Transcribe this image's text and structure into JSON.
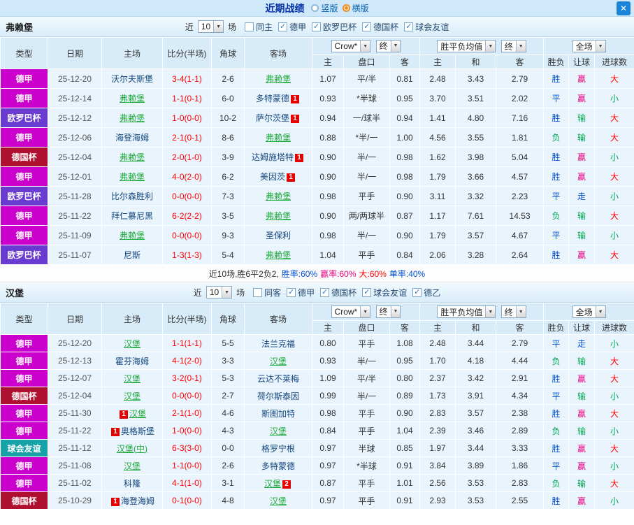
{
  "titlebar": {
    "title": "近期战绩",
    "radio_vertical": "竖版",
    "radio_horizontal": "横版",
    "close_icon": "✕"
  },
  "colors": {
    "type_colors": {
      "德甲": "#cc00cc",
      "欧罗巴杯": "#6a3bd1",
      "德国杯": "#b01030",
      "球会友谊": "#17a2a8"
    },
    "result_colors": {
      "胜": "#0050d0",
      "平": "#0050d0",
      "负": "#00a651",
      "赢": "#e6007e",
      "输": "#00a651",
      "走": "#0050d0",
      "大": "#ff0000",
      "小": "#00a651"
    }
  },
  "sections": [
    {
      "team": "弗赖堡",
      "filter": {
        "prefix": "近",
        "count": "10",
        "suffix": "场",
        "checkboxes": [
          {
            "label": "同主",
            "checked": false
          },
          {
            "label": "德甲",
            "checked": true
          },
          {
            "label": "欧罗巴杯",
            "checked": true
          },
          {
            "label": "德国杯",
            "checked": true
          },
          {
            "label": "球会友谊",
            "checked": true
          }
        ]
      },
      "header": {
        "static": [
          "类型",
          "日期",
          "主场",
          "比分(半场)",
          "角球",
          "客场"
        ],
        "odds_source": "Crow*",
        "odds_period": "终",
        "wdl_avg": "胜平负均值",
        "wdl_period": "终",
        "scope": "全场",
        "sub": [
          "主",
          "盘口",
          "客",
          "主",
          "和",
          "客",
          "胜负",
          "让球",
          "进球数"
        ]
      },
      "rows": [
        {
          "type": "德甲",
          "date": "25-12-20",
          "home": "沃尔夫斯堡",
          "home_focus": false,
          "home_badge": "",
          "score": "3-4(1-1)",
          "corner": "2-6",
          "away": "弗赖堡",
          "away_focus": true,
          "away_badge": "",
          "ah_home": "1.07",
          "handicap": "平/半",
          "ah_away": "0.81",
          "eu_home": "2.48",
          "eu_draw": "3.43",
          "eu_away": "2.79",
          "res_wdl": "胜",
          "res_ah": "赢",
          "res_ou": "大"
        },
        {
          "type": "德甲",
          "date": "25-12-14",
          "home": "弗赖堡",
          "home_focus": true,
          "home_badge": "",
          "score": "1-1(0-1)",
          "corner": "6-0",
          "away": "多特蒙德",
          "away_focus": false,
          "away_badge": "1",
          "ah_home": "0.93",
          "handicap": "*半球",
          "ah_away": "0.95",
          "eu_home": "3.70",
          "eu_draw": "3.51",
          "eu_away": "2.02",
          "res_wdl": "平",
          "res_ah": "赢",
          "res_ou": "小"
        },
        {
          "type": "欧罗巴杯",
          "date": "25-12-12",
          "home": "弗赖堡",
          "home_focus": true,
          "home_badge": "",
          "score": "1-0(0-0)",
          "corner": "10-2",
          "away": "萨尔茨堡",
          "away_focus": false,
          "away_badge": "1",
          "ah_home": "0.94",
          "handicap": "一/球半",
          "ah_away": "0.94",
          "eu_home": "1.41",
          "eu_draw": "4.80",
          "eu_away": "7.16",
          "res_wdl": "胜",
          "res_ah": "输",
          "res_ou": "大"
        },
        {
          "type": "德甲",
          "date": "25-12-06",
          "home": "海登海姆",
          "home_focus": false,
          "home_badge": "",
          "score": "2-1(0-1)",
          "corner": "8-6",
          "away": "弗赖堡",
          "away_focus": true,
          "away_badge": "",
          "ah_home": "0.88",
          "handicap": "*半/一",
          "ah_away": "1.00",
          "eu_home": "4.56",
          "eu_draw": "3.55",
          "eu_away": "1.81",
          "res_wdl": "负",
          "res_ah": "输",
          "res_ou": "大"
        },
        {
          "type": "德国杯",
          "date": "25-12-04",
          "home": "弗赖堡",
          "home_focus": true,
          "home_badge": "",
          "score": "2-0(1-0)",
          "corner": "3-9",
          "away": "达姆施塔特",
          "away_focus": false,
          "away_badge": "1",
          "ah_home": "0.90",
          "handicap": "半/一",
          "ah_away": "0.98",
          "eu_home": "1.62",
          "eu_draw": "3.98",
          "eu_away": "5.04",
          "res_wdl": "胜",
          "res_ah": "赢",
          "res_ou": "小"
        },
        {
          "type": "德甲",
          "date": "25-12-01",
          "home": "弗赖堡",
          "home_focus": true,
          "home_badge": "",
          "score": "4-0(2-0)",
          "corner": "6-2",
          "away": "美因茨",
          "away_focus": false,
          "away_badge": "1",
          "ah_home": "0.90",
          "handicap": "半/一",
          "ah_away": "0.98",
          "eu_home": "1.79",
          "eu_draw": "3.66",
          "eu_away": "4.57",
          "res_wdl": "胜",
          "res_ah": "赢",
          "res_ou": "大"
        },
        {
          "type": "欧罗巴杯",
          "date": "25-11-28",
          "home": "比尔森胜利",
          "home_focus": false,
          "home_badge": "",
          "score": "0-0(0-0)",
          "corner": "7-3",
          "away": "弗赖堡",
          "away_focus": true,
          "away_badge": "",
          "ah_home": "0.98",
          "handicap": "平手",
          "ah_away": "0.90",
          "eu_home": "3.11",
          "eu_draw": "3.32",
          "eu_away": "2.23",
          "res_wdl": "平",
          "res_ah": "走",
          "res_ou": "小"
        },
        {
          "type": "德甲",
          "date": "25-11-22",
          "home": "拜仁慕尼黑",
          "home_focus": false,
          "home_badge": "",
          "score": "6-2(2-2)",
          "corner": "3-5",
          "away": "弗赖堡",
          "away_focus": true,
          "away_badge": "",
          "ah_home": "0.90",
          "handicap": "两/两球半",
          "ah_away": "0.87",
          "eu_home": "1.17",
          "eu_draw": "7.61",
          "eu_away": "14.53",
          "res_wdl": "负",
          "res_ah": "输",
          "res_ou": "大"
        },
        {
          "type": "德甲",
          "date": "25-11-09",
          "home": "弗赖堡",
          "home_focus": true,
          "home_badge": "",
          "score": "0-0(0-0)",
          "corner": "9-3",
          "away": "圣保利",
          "away_focus": false,
          "away_badge": "",
          "ah_home": "0.98",
          "handicap": "半/一",
          "ah_away": "0.90",
          "eu_home": "1.79",
          "eu_draw": "3.57",
          "eu_away": "4.67",
          "res_wdl": "平",
          "res_ah": "输",
          "res_ou": "小"
        },
        {
          "type": "欧罗巴杯",
          "date": "25-11-07",
          "home": "尼斯",
          "home_focus": false,
          "home_badge": "",
          "score": "1-3(1-3)",
          "corner": "5-4",
          "away": "弗赖堡",
          "away_focus": true,
          "away_badge": "",
          "ah_home": "1.04",
          "handicap": "平手",
          "ah_away": "0.84",
          "eu_home": "2.06",
          "eu_draw": "3.28",
          "eu_away": "2.64",
          "res_wdl": "胜",
          "res_ah": "赢",
          "res_ou": "大"
        }
      ],
      "summary": [
        {
          "text": "近10场,胜6平2负2,",
          "color": "#2b2b2b"
        },
        {
          "text": "胜率:60%",
          "color": "#0050d0"
        },
        {
          "text": "赢率:60%",
          "color": "#e6007e"
        },
        {
          "text": "大:60%",
          "color": "#ff0000"
        },
        {
          "text": "单率:40%",
          "color": "#0050d0"
        }
      ]
    },
    {
      "team": "汉堡",
      "filter": {
        "prefix": "近",
        "count": "10",
        "suffix": "场",
        "checkboxes": [
          {
            "label": "同客",
            "checked": false
          },
          {
            "label": "德甲",
            "checked": true
          },
          {
            "label": "德国杯",
            "checked": true
          },
          {
            "label": "球会友谊",
            "checked": true
          },
          {
            "label": "德乙",
            "checked": true
          }
        ]
      },
      "header": {
        "static": [
          "类型",
          "日期",
          "主场",
          "比分(半场)",
          "角球",
          "客场"
        ],
        "odds_source": "Crow*",
        "odds_period": "终",
        "wdl_avg": "胜平负均值",
        "wdl_period": "终",
        "scope": "全场",
        "sub": [
          "主",
          "盘口",
          "客",
          "主",
          "和",
          "客",
          "胜负",
          "让球",
          "进球数"
        ]
      },
      "rows": [
        {
          "type": "德甲",
          "date": "25-12-20",
          "home": "汉堡",
          "home_focus": true,
          "home_badge": "",
          "score": "1-1(1-1)",
          "corner": "5-5",
          "away": "法兰克福",
          "away_focus": false,
          "away_badge": "",
          "ah_home": "0.80",
          "handicap": "平手",
          "ah_away": "1.08",
          "eu_home": "2.48",
          "eu_draw": "3.44",
          "eu_away": "2.79",
          "res_wdl": "平",
          "res_ah": "走",
          "res_ou": "小"
        },
        {
          "type": "德甲",
          "date": "25-12-13",
          "home": "霍芬海姆",
          "home_focus": false,
          "home_badge": "",
          "score": "4-1(2-0)",
          "corner": "3-3",
          "away": "汉堡",
          "away_focus": true,
          "away_badge": "",
          "ah_home": "0.93",
          "handicap": "半/一",
          "ah_away": "0.95",
          "eu_home": "1.70",
          "eu_draw": "4.18",
          "eu_away": "4.44",
          "res_wdl": "负",
          "res_ah": "输",
          "res_ou": "大"
        },
        {
          "type": "德甲",
          "date": "25-12-07",
          "home": "汉堡",
          "home_focus": true,
          "home_badge": "",
          "score": "3-2(0-1)",
          "corner": "5-3",
          "away": "云达不莱梅",
          "away_focus": false,
          "away_badge": "",
          "ah_home": "1.09",
          "handicap": "平/半",
          "ah_away": "0.80",
          "eu_home": "2.37",
          "eu_draw": "3.42",
          "eu_away": "2.91",
          "res_wdl": "胜",
          "res_ah": "赢",
          "res_ou": "大"
        },
        {
          "type": "德国杯",
          "date": "25-12-04",
          "home": "汉堡",
          "home_focus": true,
          "home_badge": "",
          "score": "0-0(0-0)",
          "corner": "2-7",
          "away": "荷尔斯泰因",
          "away_focus": false,
          "away_badge": "",
          "ah_home": "0.99",
          "handicap": "半/一",
          "ah_away": "0.89",
          "eu_home": "1.73",
          "eu_draw": "3.91",
          "eu_away": "4.34",
          "res_wdl": "平",
          "res_ah": "输",
          "res_ou": "小"
        },
        {
          "type": "德甲",
          "date": "25-11-30",
          "home": "汉堡",
          "home_focus": true,
          "home_badge": "1",
          "score": "2-1(1-0)",
          "corner": "4-6",
          "away": "斯图加特",
          "away_focus": false,
          "away_badge": "",
          "ah_home": "0.98",
          "handicap": "平手",
          "ah_away": "0.90",
          "eu_home": "2.83",
          "eu_draw": "3.57",
          "eu_away": "2.38",
          "res_wdl": "胜",
          "res_ah": "赢",
          "res_ou": "大"
        },
        {
          "type": "德甲",
          "date": "25-11-22",
          "home": "奥格斯堡",
          "home_focus": false,
          "home_badge": "1",
          "score": "1-0(0-0)",
          "corner": "4-3",
          "away": "汉堡",
          "away_focus": true,
          "away_badge": "",
          "ah_home": "0.84",
          "handicap": "平手",
          "ah_away": "1.04",
          "eu_home": "2.39",
          "eu_draw": "3.46",
          "eu_away": "2.89",
          "res_wdl": "负",
          "res_ah": "输",
          "res_ou": "小"
        },
        {
          "type": "球会友谊",
          "date": "25-11-12",
          "home": "汉堡(中)",
          "home_focus": true,
          "home_badge": "",
          "score": "6-3(3-0)",
          "corner": "0-0",
          "away": "格罗宁根",
          "away_focus": false,
          "away_badge": "",
          "ah_home": "0.97",
          "handicap": "半球",
          "ah_away": "0.85",
          "eu_home": "1.97",
          "eu_draw": "3.44",
          "eu_away": "3.33",
          "res_wdl": "胜",
          "res_ah": "赢",
          "res_ou": "大"
        },
        {
          "type": "德甲",
          "date": "25-11-08",
          "home": "汉堡",
          "home_focus": true,
          "home_badge": "",
          "score": "1-1(0-0)",
          "corner": "2-6",
          "away": "多特蒙德",
          "away_focus": false,
          "away_badge": "",
          "ah_home": "0.97",
          "handicap": "*半球",
          "ah_away": "0.91",
          "eu_home": "3.84",
          "eu_draw": "3.89",
          "eu_away": "1.86",
          "res_wdl": "平",
          "res_ah": "赢",
          "res_ou": "小"
        },
        {
          "type": "德甲",
          "date": "25-11-02",
          "home": "科隆",
          "home_focus": false,
          "home_badge": "",
          "score": "4-1(1-0)",
          "corner": "3-1",
          "away": "汉堡",
          "away_focus": true,
          "away_badge": "2",
          "ah_home": "0.87",
          "handicap": "平手",
          "ah_away": "1.01",
          "eu_home": "2.56",
          "eu_draw": "3.53",
          "eu_away": "2.83",
          "res_wdl": "负",
          "res_ah": "输",
          "res_ou": "大"
        },
        {
          "type": "德国杯",
          "date": "25-10-29",
          "home": "海登海姆",
          "home_focus": false,
          "home_badge": "1",
          "score": "0-1(0-0)",
          "corner": "4-8",
          "away": "汉堡",
          "away_focus": true,
          "away_badge": "",
          "ah_home": "0.97",
          "handicap": "平手",
          "ah_away": "0.91",
          "eu_home": "2.93",
          "eu_draw": "3.53",
          "eu_away": "2.55",
          "res_wdl": "胜",
          "res_ah": "赢",
          "res_ou": "小"
        }
      ],
      "summary": null
    }
  ]
}
